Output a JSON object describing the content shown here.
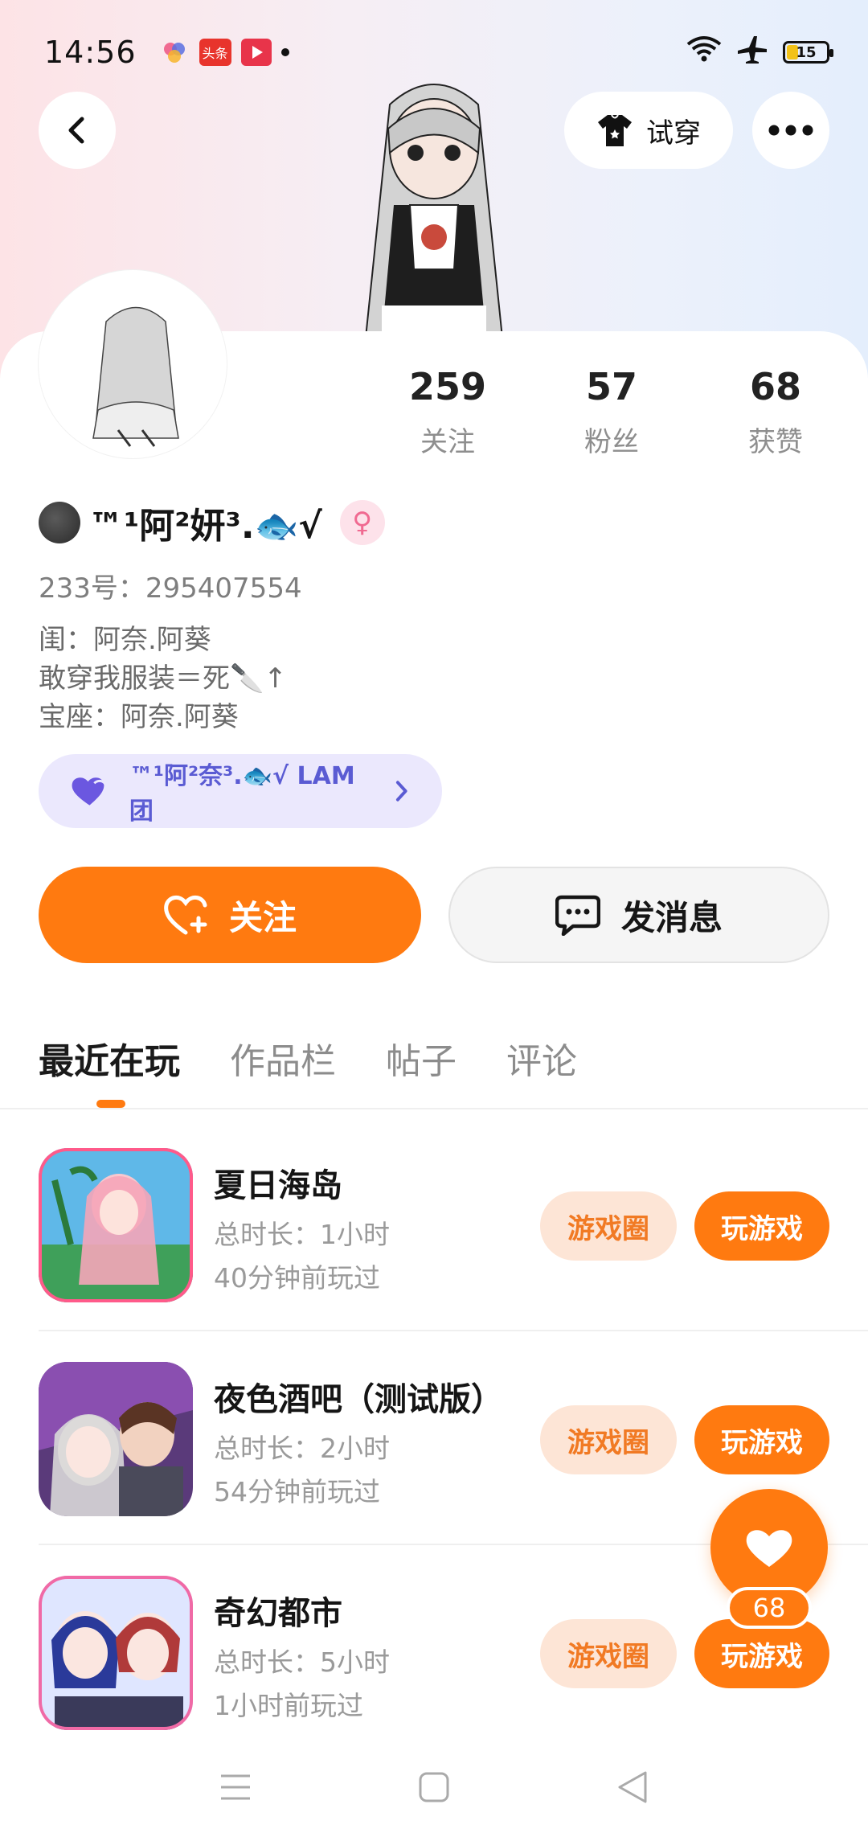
{
  "status_bar": {
    "time": "14:56",
    "notif_toutiao": "头条",
    "battery": "15"
  },
  "header": {
    "tryon_label": "试穿"
  },
  "stats": [
    {
      "value": "259",
      "label": "关注"
    },
    {
      "value": "57",
      "label": "粉丝"
    },
    {
      "value": "68",
      "label": "获赞"
    }
  ],
  "profile": {
    "name": "™¹阿²妍³.🐟√",
    "gender": "♀",
    "uid": "233号：295407554",
    "bio": [
      "闺：阿奈.阿葵",
      "敢穿我服装＝死🔪↑",
      "宝座：阿奈.阿葵"
    ],
    "team": "™¹阿²奈³.🐟√ LAM团"
  },
  "actions": {
    "follow": "关注",
    "message": "发消息"
  },
  "tabs": [
    "最近在玩",
    "作品栏",
    "帖子",
    "评论"
  ],
  "games": [
    {
      "title": "夏日海岛",
      "duration": "总时长：1小时",
      "last_played": "40分钟前玩过",
      "circle_btn": "游戏圈",
      "play_btn": "玩游戏"
    },
    {
      "title": "夜色酒吧（测试版）",
      "duration": "总时长：2小时",
      "last_played": "54分钟前玩过",
      "circle_btn": "游戏圈",
      "play_btn": "玩游戏"
    },
    {
      "title": "奇幻都市",
      "duration": "总时长：5小时",
      "last_played": "1小时前玩过",
      "circle_btn": "游戏圈",
      "play_btn": "玩游戏"
    }
  ],
  "like_fab": {
    "count": "68"
  },
  "colors": {
    "accent": "#ff7a10",
    "team_bg": "#ebe8fd",
    "team_text": "#5a5bd3"
  }
}
